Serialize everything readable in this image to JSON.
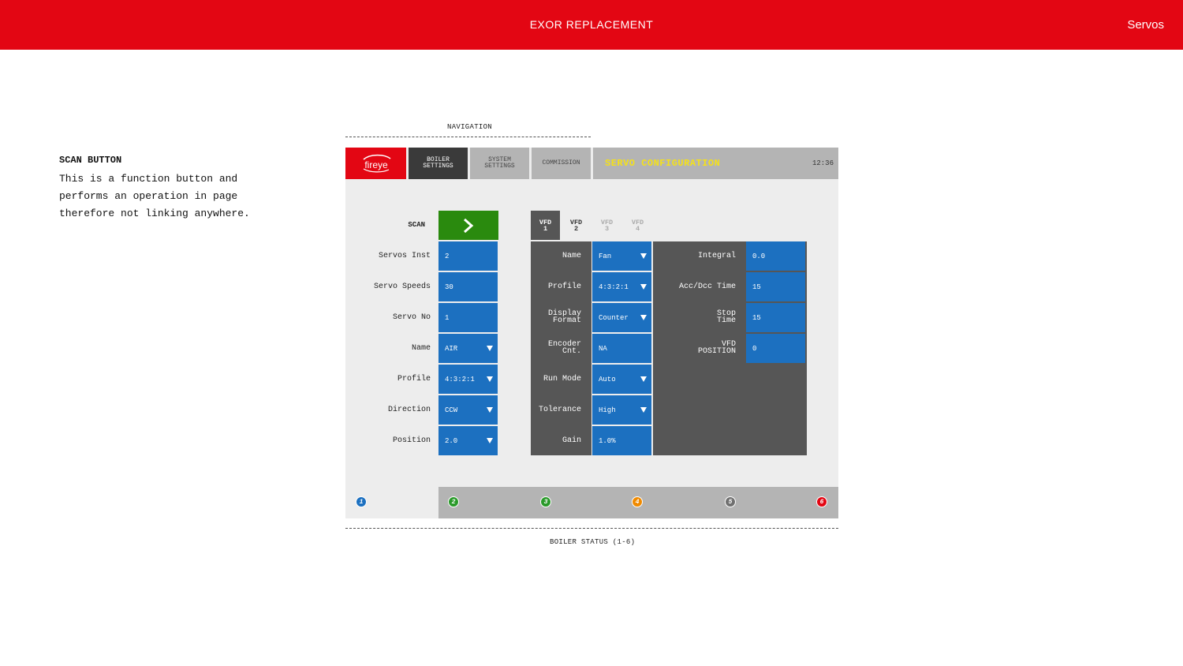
{
  "header": {
    "title": "EXOR REPLACEMENT",
    "section": "Servos",
    "bg": "#e30613"
  },
  "annotation": {
    "title": "SCAN BUTTON",
    "body": "This is a function button and\nperforms an operation in page\ntherefore not linking anywhere."
  },
  "captions": {
    "navigation": "NAVIGATION",
    "boiler_status": "BOILER STATUS (1-6)"
  },
  "hmi": {
    "logo": "fireye",
    "nav": {
      "boiler": "BOILER\nSETTINGS",
      "system": "SYSTEM\nSETTINGS",
      "commission": "COMMISSION"
    },
    "screen_title": "SERVO CONFIGURATION",
    "clock": "12:36",
    "scan_label": "SCAN",
    "servo_fields": [
      {
        "label": "Servos Inst",
        "value": "2",
        "dropdown": false
      },
      {
        "label": "Servo Speeds",
        "value": "30",
        "dropdown": false
      },
      {
        "label": "Servo No",
        "value": "1",
        "dropdown": false
      },
      {
        "label": "Name",
        "value": "AIR",
        "dropdown": true
      },
      {
        "label": "Profile",
        "value": "4:3:2:1",
        "dropdown": true
      },
      {
        "label": "Direction",
        "value": "CCW",
        "dropdown": true
      },
      {
        "label": "Position",
        "value": "2.0",
        "dropdown": true
      }
    ],
    "vfd_tabs": [
      {
        "label": "VFD\n1",
        "state": "active"
      },
      {
        "label": "VFD\n2",
        "state": "enabled"
      },
      {
        "label": "VFD\n3",
        "state": "disabled"
      },
      {
        "label": "VFD\n4",
        "state": "disabled"
      }
    ],
    "vfd_fields_left": [
      {
        "label": "Name",
        "value": "Fan",
        "dropdown": true
      },
      {
        "label": "Profile",
        "value": "4:3:2:1",
        "dropdown": true
      },
      {
        "label": "Display\nFormat",
        "value": "Counter",
        "dropdown": true
      },
      {
        "label": "Encoder\nCnt.",
        "value": "NA",
        "dropdown": false
      },
      {
        "label": "Run Mode",
        "value": "Auto",
        "dropdown": true
      },
      {
        "label": "Tolerance",
        "value": "High",
        "dropdown": true
      },
      {
        "label": "Gain",
        "value": "1.0%",
        "dropdown": false
      }
    ],
    "vfd_fields_right": [
      {
        "label": "Integral",
        "value": "0.0"
      },
      {
        "label": "Acc/Dcc Time",
        "value": "15"
      },
      {
        "label": "Stop\nTime",
        "value": "15"
      },
      {
        "label": "VFD\nPOSITION",
        "value": "0"
      }
    ],
    "boilers": [
      {
        "num": "1",
        "color": "#1c70c0"
      },
      {
        "num": "2",
        "color": "#2a9a2a"
      },
      {
        "num": "3",
        "color": "#2a9a2a"
      },
      {
        "num": "4",
        "color": "#f08a00"
      },
      {
        "num": "5",
        "color": "#707070"
      },
      {
        "num": "6",
        "color": "#e30613"
      }
    ]
  }
}
